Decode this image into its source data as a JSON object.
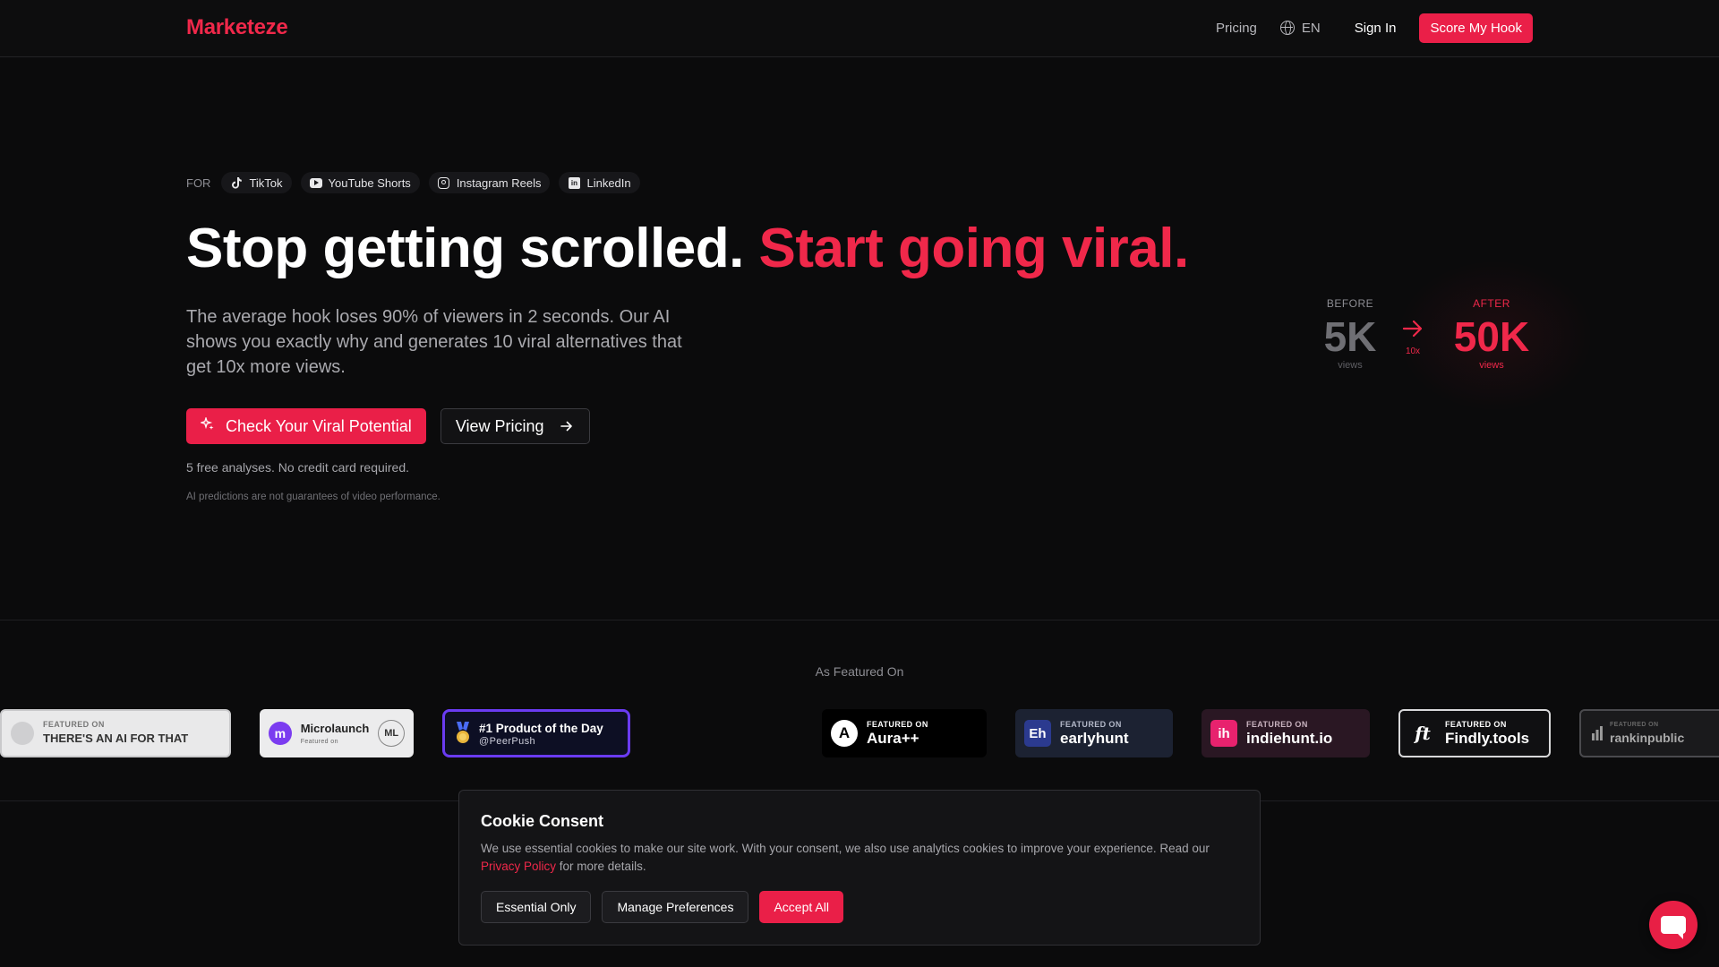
{
  "header": {
    "logo": "Marketeze",
    "nav_pricing": "Pricing",
    "lang": "EN",
    "signin": "Sign In",
    "cta": "Score My Hook"
  },
  "platforms": {
    "label": "FOR",
    "items": [
      {
        "label": "TikTok",
        "icon": "tiktok-icon"
      },
      {
        "label": "YouTube Shorts",
        "icon": "youtube-icon"
      },
      {
        "label": "Instagram Reels",
        "icon": "instagram-icon"
      },
      {
        "label": "LinkedIn",
        "icon": "linkedin-icon"
      }
    ]
  },
  "hero": {
    "title_main": "Stop getting scrolled.",
    "title_accent": "Start going viral.",
    "description": "The average hook loses 90% of viewers in 2 seconds. Our AI shows you exactly why and generates 10 viral alternatives that get 10x more views.",
    "primary_cta": "Check Your Viral Potential",
    "secondary_cta": "View Pricing",
    "free_note": "5 free analyses. No credit card required.",
    "disclaimer": "AI predictions are not guarantees of video performance."
  },
  "stats": {
    "before_label": "BEFORE",
    "before_value": "5K",
    "before_sub": "views",
    "multiplier": "10x",
    "after_label": "AFTER",
    "after_value": "50K",
    "after_sub": "views"
  },
  "featured": {
    "label": "As Featured On",
    "badges": {
      "aift": {
        "small": "FEATURED ON",
        "big": "THERE'S AN AI FOR THAT"
      },
      "micro": {
        "big": "Microlaunch",
        "small": "Featured on",
        "mark": "ML"
      },
      "peer": {
        "big": "#1 Product of the Day",
        "small": "@PeerPush"
      },
      "aura": {
        "small": "FEATURED ON",
        "big": "Aura++",
        "mark": "A"
      },
      "early": {
        "small": "FEATURED ON",
        "big": "earlyhunt",
        "mark": "Eh"
      },
      "indie": {
        "small": "FEATURED ON",
        "big": "indiehunt.io",
        "mark": "ih"
      },
      "findly": {
        "small": "FEATURED ON",
        "big": "Findly.tools",
        "mark": "ft"
      },
      "rank": {
        "big": "rankinpublic",
        "small": "FEATURED ON"
      }
    }
  },
  "cookie": {
    "title": "Cookie Consent",
    "text_before": "We use essential cookies to make our site work. With your consent, we also use analytics cookies to improve your experience. Read our ",
    "link": "Privacy Policy",
    "text_after": " for more details.",
    "essential": "Essential Only",
    "manage": "Manage Preferences",
    "accept": "Accept All"
  },
  "colors": {
    "accent": "#ea1f48",
    "background": "#0b0b0c"
  }
}
